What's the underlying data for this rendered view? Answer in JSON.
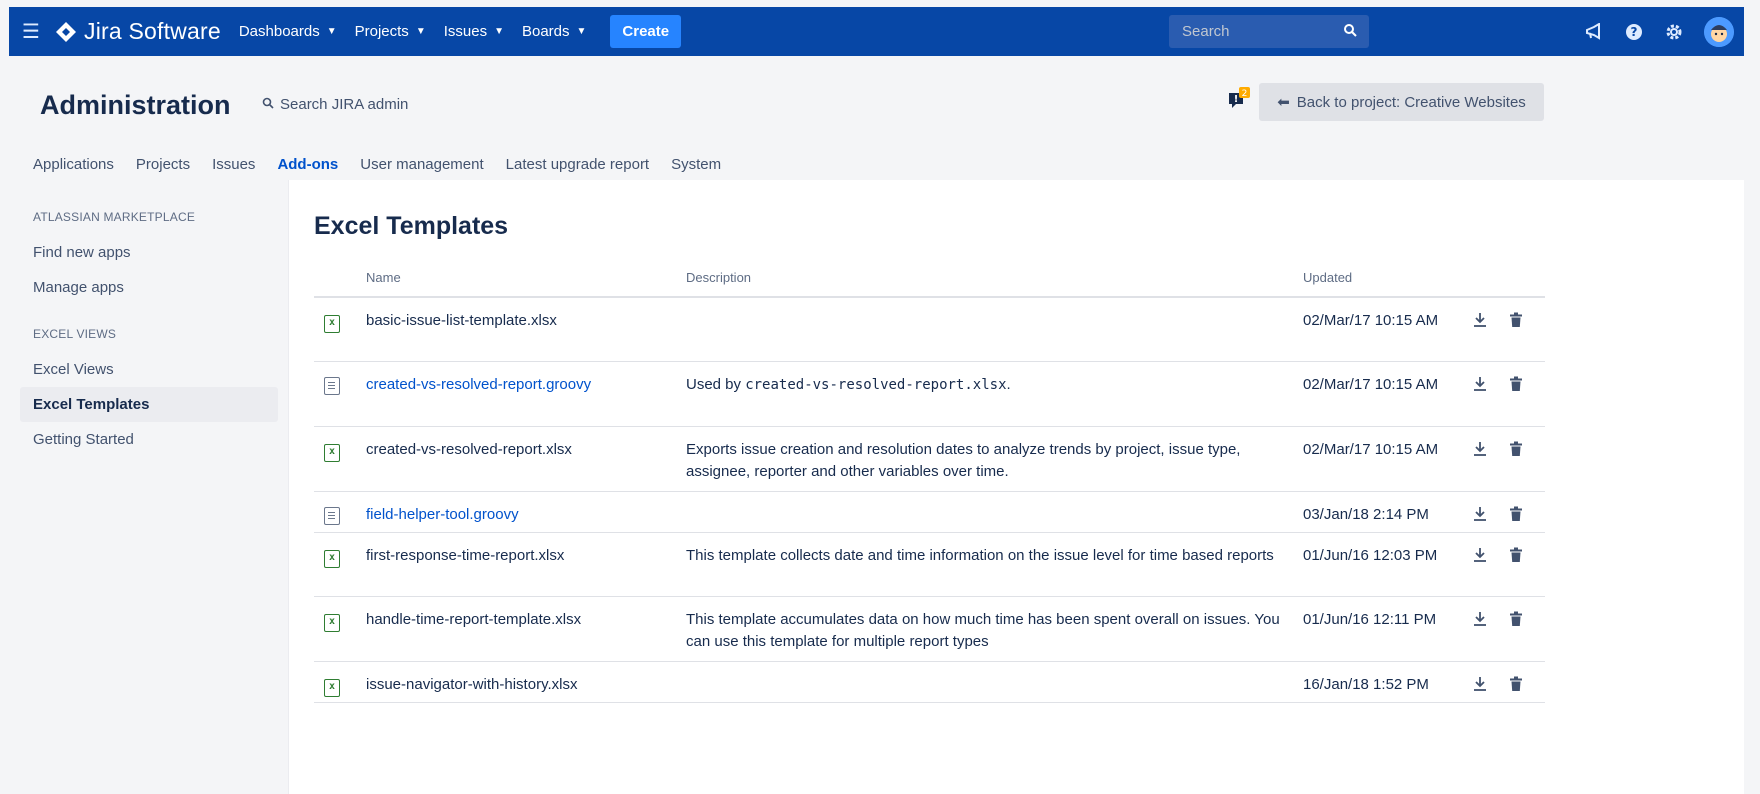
{
  "topbar": {
    "product_name": "Jira Software",
    "nav": [
      {
        "label": "Dashboards"
      },
      {
        "label": "Projects"
      },
      {
        "label": "Issues"
      },
      {
        "label": "Boards"
      }
    ],
    "create_label": "Create",
    "search_placeholder": "Search",
    "brand_color": "#0747a6",
    "accent_color": "#2684ff"
  },
  "admin": {
    "title": "Administration",
    "search_label": "Search JIRA admin",
    "notification_count": "2",
    "back_label": "Back to project: Creative Websites",
    "tabs": [
      {
        "label": "Applications",
        "active": false
      },
      {
        "label": "Projects",
        "active": false
      },
      {
        "label": "Issues",
        "active": false
      },
      {
        "label": "Add-ons",
        "active": true
      },
      {
        "label": "User management",
        "active": false
      },
      {
        "label": "Latest upgrade report",
        "active": false
      },
      {
        "label": "System",
        "active": false
      }
    ]
  },
  "sidebar": {
    "sections": [
      {
        "heading": "ATLASSIAN MARKETPLACE",
        "items": [
          {
            "label": "Find new apps",
            "active": false
          },
          {
            "label": "Manage apps",
            "active": false
          }
        ]
      },
      {
        "heading": "EXCEL VIEWS",
        "items": [
          {
            "label": "Excel Views",
            "active": false
          },
          {
            "label": "Excel Templates",
            "active": true
          },
          {
            "label": "Getting Started",
            "active": false
          }
        ]
      }
    ]
  },
  "main": {
    "title": "Excel Templates",
    "columns": {
      "name": "Name",
      "description": "Description",
      "updated": "Updated"
    },
    "rows": [
      {
        "icon": "excel-file-icon",
        "name": "basic-issue-list-template.xlsx",
        "link": false,
        "description": "",
        "desc_code": "",
        "desc_after": "",
        "updated": "02/Mar/17 10:15 AM"
      },
      {
        "icon": "script-file-icon",
        "name": "created-vs-resolved-report.groovy",
        "link": true,
        "description": "Used by ",
        "desc_code": "created-vs-resolved-report.xlsx",
        "desc_after": ".",
        "updated": "02/Mar/17 10:15 AM"
      },
      {
        "icon": "excel-file-icon",
        "name": "created-vs-resolved-report.xlsx",
        "link": false,
        "description": "Exports issue creation and resolution dates to analyze trends by project, issue type, assignee, reporter and other variables over time.",
        "desc_code": "",
        "desc_after": "",
        "updated": "02/Mar/17 10:15 AM"
      },
      {
        "icon": "script-file-icon",
        "name": "field-helper-tool.groovy",
        "link": true,
        "description": "",
        "desc_code": "",
        "desc_after": "",
        "updated": "03/Jan/18 2:14 PM"
      },
      {
        "icon": "excel-file-icon",
        "name": "first-response-time-report.xlsx",
        "link": false,
        "description": "This template collects date and time information on the issue level for time based reports",
        "desc_code": "",
        "desc_after": "",
        "updated": "01/Jun/16 12:03 PM"
      },
      {
        "icon": "excel-file-icon",
        "name": "handle-time-report-template.xlsx",
        "link": false,
        "description": "This template accumulates data on how much time has been spent overall on issues. You can use this template for multiple report types",
        "desc_code": "",
        "desc_after": "",
        "updated": "01/Jun/16 12:11 PM"
      },
      {
        "icon": "excel-file-icon",
        "name": "issue-navigator-with-history.xlsx",
        "link": false,
        "description": "",
        "desc_code": "",
        "desc_after": "",
        "updated": "16/Jan/18 1:52 PM"
      }
    ]
  }
}
